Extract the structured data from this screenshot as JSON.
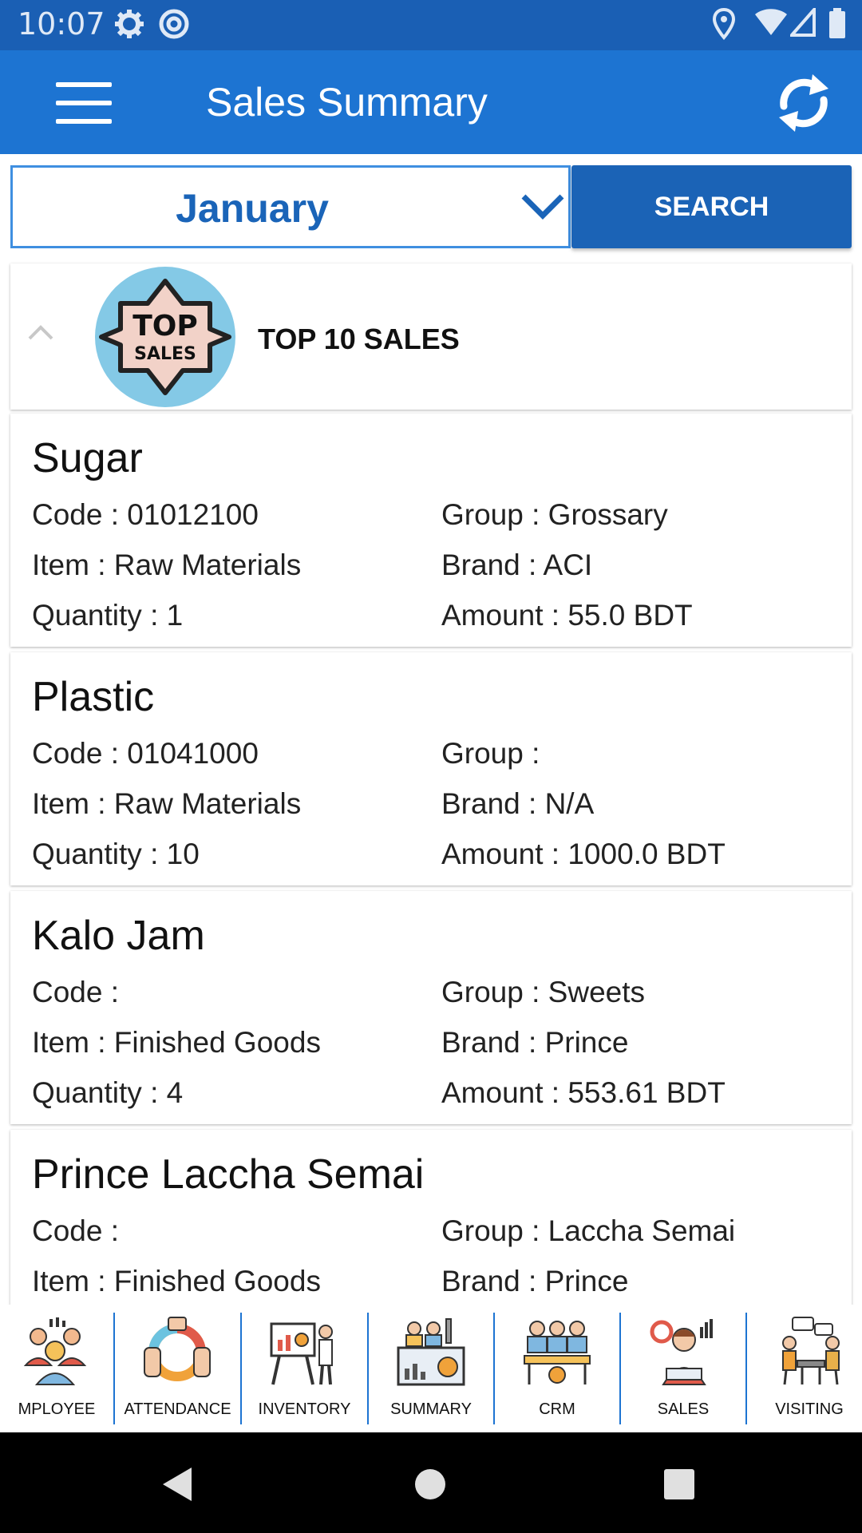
{
  "status_bar": {
    "time": "10:07"
  },
  "app_bar": {
    "title": "Sales Summary"
  },
  "filter": {
    "month": "January",
    "search_label": "SEARCH"
  },
  "top_sales": {
    "title": "TOP 10 SALES",
    "badge_line1": "TOP",
    "badge_line2": "SALES"
  },
  "products": [
    {
      "name": "Sugar",
      "code": "Code : 01012100",
      "group": "Group : Grossary",
      "item": "Item : Raw Materials",
      "brand": "Brand : ACI",
      "quantity": "Quantity : 1",
      "amount": "Amount : 55.0 BDT"
    },
    {
      "name": "Plastic",
      "code": "Code : 01041000",
      "group": "Group :",
      "item": "Item : Raw Materials",
      "brand": "Brand : N/A",
      "quantity": "Quantity : 10",
      "amount": "Amount : 1000.0 BDT"
    },
    {
      "name": "Kalo Jam",
      "code": "Code :",
      "group": "Group : Sweets",
      "item": "Item : Finished Goods",
      "brand": "Brand : Prince",
      "quantity": "Quantity : 4",
      "amount": "Amount : 553.61 BDT"
    },
    {
      "name": "Prince Laccha Semai",
      "code": "Code :",
      "group": "Group : Laccha Semai",
      "item": "Item : Finished Goods",
      "brand": "Brand : Prince"
    }
  ],
  "bottom_nav": [
    {
      "label": "MPLOYEE",
      "icon": "employee-icon"
    },
    {
      "label": "ATTENDANCE",
      "icon": "attendance-icon"
    },
    {
      "label": "INVENTORY",
      "icon": "inventory-icon"
    },
    {
      "label": "SUMMARY",
      "icon": "summary-icon"
    },
    {
      "label": "CRM",
      "icon": "crm-icon"
    },
    {
      "label": "SALES",
      "icon": "sales-icon"
    },
    {
      "label": "VISITING",
      "icon": "visiting-icon"
    }
  ],
  "colors": {
    "primary": "#1d74d2",
    "status": "#1a5fb4",
    "button": "#1b63b6",
    "month_text": "#1a64b8"
  }
}
